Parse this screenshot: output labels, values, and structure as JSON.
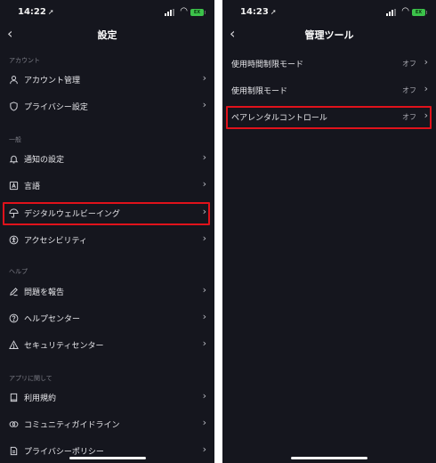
{
  "left": {
    "status": {
      "time": "14:22",
      "battery": "EX"
    },
    "nav": {
      "title": "設定"
    },
    "sections": [
      {
        "label": "アカウント",
        "items": [
          {
            "icon": "person-icon",
            "label": "アカウント管理"
          },
          {
            "icon": "shield-icon",
            "label": "プライバシー設定"
          }
        ]
      },
      {
        "label": "一般",
        "items": [
          {
            "icon": "bell-icon",
            "label": "通知の設定"
          },
          {
            "icon": "language-icon",
            "label": "言語"
          },
          {
            "icon": "umbrella-icon",
            "label": "デジタルウェルビーイング"
          },
          {
            "icon": "accessibility-icon",
            "label": "アクセシビリティ"
          }
        ]
      },
      {
        "label": "ヘルプ",
        "items": [
          {
            "icon": "pencil-icon",
            "label": "問題を報告"
          },
          {
            "icon": "question-icon",
            "label": "ヘルプセンター"
          },
          {
            "icon": "warning-icon",
            "label": "セキュリティセンター"
          }
        ]
      },
      {
        "label": "アプリに関して",
        "items": [
          {
            "icon": "book-icon",
            "label": "利用規約"
          },
          {
            "icon": "community-icon",
            "label": "コミュニティガイドライン"
          },
          {
            "icon": "document-icon",
            "label": "プライバシーポリシー"
          }
        ]
      }
    ]
  },
  "right": {
    "status": {
      "time": "14:23",
      "battery": "EX"
    },
    "nav": {
      "title": "管理ツール"
    },
    "items": [
      {
        "label": "使用時間制限モード",
        "value": "オフ"
      },
      {
        "label": "使用制限モード",
        "value": "オフ"
      },
      {
        "label": "ペアレンタルコントロール",
        "value": "オフ"
      }
    ]
  },
  "colors": {
    "background": "#15161e",
    "highlight": "#e0121b",
    "battery": "#3cc24a"
  }
}
